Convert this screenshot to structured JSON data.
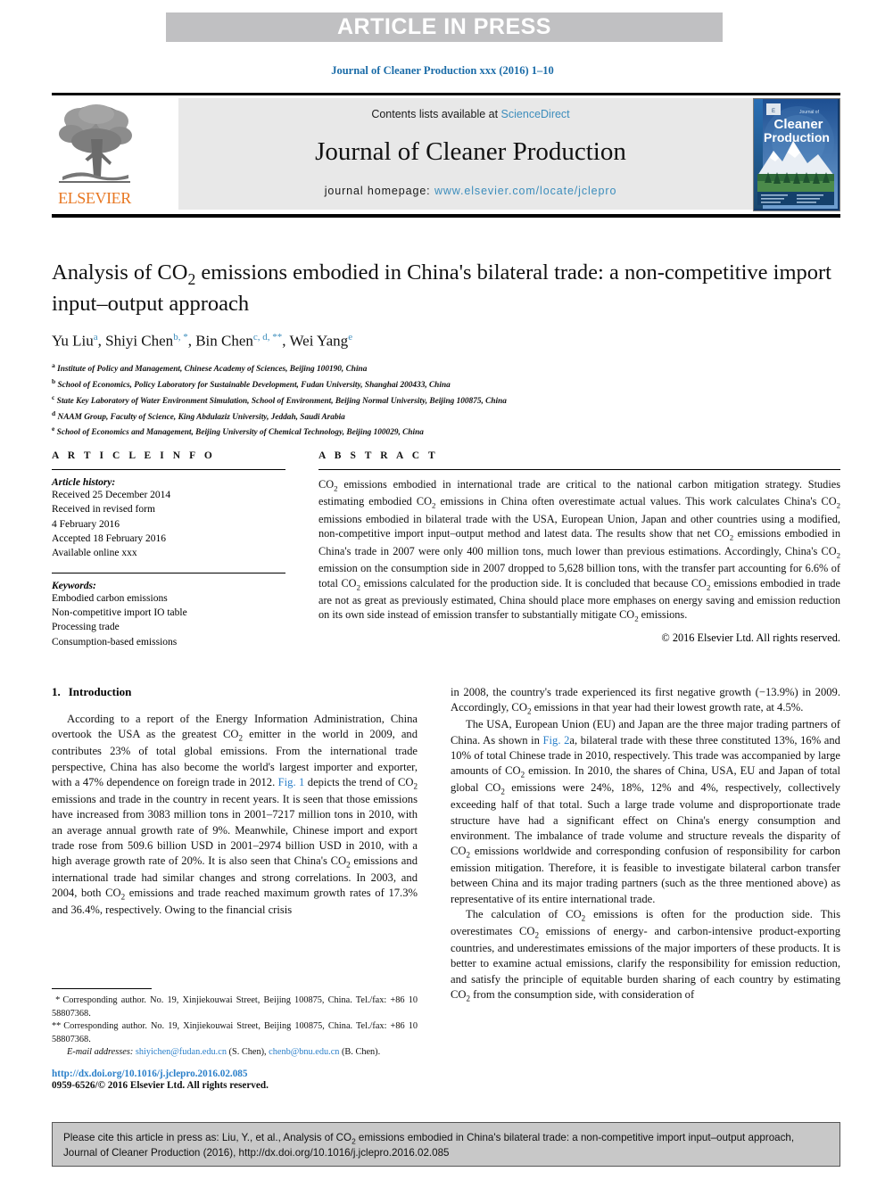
{
  "banner": {
    "text": "ARTICLE IN PRESS"
  },
  "journal_ref": "Journal of Cleaner Production xxx (2016) 1–10",
  "masthead": {
    "publisher_logo_label": "ELSEVIER",
    "contents_prefix": "Contents lists available at ",
    "contents_link": "ScienceDirect",
    "journal_name": "Journal of Cleaner Production",
    "homepage_prefix": "journal homepage: ",
    "homepage_url": "www.elsevier.com/locate/jclepro",
    "cover_title_small": "Journal of",
    "cover_title_line1": "Cleaner",
    "cover_title_line2": "Production"
  },
  "article": {
    "title": "Analysis of CO2 emissions embodied in China's bilateral trade: a non-competitive import input–output approach",
    "title_part1": "Analysis of CO",
    "title_sub": "2",
    "title_part2": " emissions embodied in China's bilateral trade: a non-competitive import input–output approach",
    "authors": [
      {
        "name": "Yu Liu",
        "marks": "a"
      },
      {
        "name": "Shiyi Chen",
        "marks": "b, *"
      },
      {
        "name": "Bin Chen",
        "marks": "c, d, **"
      },
      {
        "name": "Wei Yang",
        "marks": "e"
      }
    ],
    "affiliations": [
      {
        "mark": "a",
        "text": "Institute of Policy and Management, Chinese Academy of Sciences, Beijing 100190, China"
      },
      {
        "mark": "b",
        "text": "School of Economics, Policy Laboratory for Sustainable Development, Fudan University, Shanghai 200433, China"
      },
      {
        "mark": "c",
        "text": "State Key Laboratory of Water Environment Simulation, School of Environment, Beijing Normal University, Beijing 100875, China"
      },
      {
        "mark": "d",
        "text": "NAAM Group, Faculty of Science, King Abdulaziz University, Jeddah, Saudi Arabia"
      },
      {
        "mark": "e",
        "text": "School of Economics and Management, Beijing University of Chemical Technology, Beijing 100029, China"
      }
    ]
  },
  "article_info": {
    "heading": "A R T I C L E  I N F O",
    "history_label": "Article history:",
    "history": [
      "Received 25 December 2014",
      "Received in revised form",
      "4 February 2016",
      "Accepted 18 February 2016",
      "Available online xxx"
    ],
    "keywords_label": "Keywords:",
    "keywords": [
      "Embodied carbon emissions",
      "Non-competitive import IO table",
      "Processing trade",
      "Consumption-based emissions"
    ]
  },
  "abstract": {
    "heading": "A B S T R A C T",
    "p1_a": "CO",
    "p1_b": " emissions embodied in international trade are critical to the national carbon mitigation strategy. Studies estimating embodied CO",
    "p1_c": " emissions in China often overestimate actual values. This work calculates China's CO",
    "p1_d": " emissions embodied in bilateral trade with the USA, European Union, Japan and other countries using a modified, non-competitive import input–output method and latest data. The results show that net CO",
    "p1_e": " emissions embodied in China's trade in 2007 were only 400 million tons, much lower than previous estimations. Accordingly, China's CO",
    "p1_f": " emission on the consumption side in 2007 dropped to 5,628 billion tons, with the transfer part accounting for 6.6% of total CO",
    "p1_g": " emissions calculated for the production side. It is concluded that because CO",
    "p1_h": " emissions embodied in trade are not as great as previously estimated, China should place more emphases on energy saving and emission reduction on its own side instead of emission transfer to substantially mitigate CO",
    "p1_i": " emissions.",
    "copyright": "© 2016 Elsevier Ltd. All rights reserved."
  },
  "body": {
    "section_number": "1.",
    "section_title": "Introduction",
    "left_p1_a": "According to a report of the Energy Information Administration, China overtook the USA as the greatest CO",
    "left_p1_b": " emitter in the world in 2009, and contributes 23% of total global emissions. From the international trade perspective, China has also become the world's largest importer and exporter, with a 47% dependence on foreign trade in 2012. ",
    "left_p1_figref": "Fig. 1",
    "left_p1_c": " depicts the trend of CO",
    "left_p1_d": " emissions and trade in the country in recent years. It is seen that those emissions have increased from 3083 million tons in 2001–7217 million tons in 2010, with an average annual growth rate of 9%. Meanwhile, Chinese import and export trade rose from 509.6 billion USD in 2001–2974 billion USD in 2010, with a high average growth rate of 20%. It is also seen that China's CO",
    "left_p1_e": " emissions and international trade had similar changes and strong correlations. In 2003, and 2004, both CO",
    "left_p1_f": " emissions and trade reached maximum growth rates of 17.3% and 36.4%, respectively. Owing to the financial crisis",
    "right_p1_a": "in 2008, the country's trade experienced its first negative growth (−13.9%) in 2009. Accordingly, CO",
    "right_p1_b": " emissions in that year had their lowest growth rate, at 4.5%.",
    "right_p2_a": "The USA, European Union (EU) and Japan are the three major trading partners of China. As shown in ",
    "right_p2_figref": "Fig. 2",
    "right_p2_b": "a, bilateral trade with these three constituted 13%, 16% and 10% of total Chinese trade in 2010, respectively. This trade was accompanied by large amounts of CO",
    "right_p2_c": " emission. In 2010, the shares of China, USA, EU and Japan of total global CO",
    "right_p2_d": " emissions were 24%, 18%, 12% and 4%, respectively, collectively exceeding half of that total. Such a large trade volume and disproportionate trade structure have had a significant effect on China's energy consumption and environment. The imbalance of trade volume and structure reveals the disparity of CO",
    "right_p2_e": " emissions worldwide and corresponding confusion of responsibility for carbon emission mitigation. Therefore, it is feasible to investigate bilateral carbon transfer between China and its major trading partners (such as the three mentioned above) as representative of its entire international trade.",
    "right_p3_a": "The calculation of CO",
    "right_p3_b": " emissions is often for the production side. This overestimates CO",
    "right_p3_c": " emissions of energy- and carbon-intensive product-exporting countries, and underestimates emissions of the major importers of these products. It is better to examine actual emissions, clarify the responsibility for emission reduction, and satisfy the principle of equitable burden sharing of each country by estimating CO",
    "right_p3_d": " from the consumption side, with consideration of"
  },
  "footnotes": {
    "fn1_mark": "*",
    "fn1_text": "Corresponding author. No. 19, Xinjiekouwai Street, Beijing 100875, China. Tel./fax: +86 10 58807368.",
    "fn2_mark": "**",
    "fn2_text": "Corresponding author. No. 19, Xinjiekouwai Street, Beijing 100875, China. Tel./fax: +86 10 58807368.",
    "email_label": "E-mail addresses:",
    "email1": "shiyichen@fudan.edu.cn",
    "email1_owner": "(S. Chen),",
    "email2": "chenb@bnu.edu.cn",
    "email2_owner": "(B. Chen)."
  },
  "doi": {
    "url": "http://dx.doi.org/10.1016/j.jclepro.2016.02.085",
    "issn_line": "0959-6526/© 2016 Elsevier Ltd. All rights reserved."
  },
  "citation_box": {
    "prefix": "Please cite this article in press as: Liu, Y., et al., Analysis of CO",
    "sub": "2",
    "suffix": " emissions embodied in China's bilateral trade: a non-competitive import input–output approach, Journal of Cleaner Production (2016), http://dx.doi.org/10.1016/j.jclepro.2016.02.085"
  },
  "colors": {
    "banner_gray": "#c0c0c2",
    "link_blue": "#3c8dbc",
    "journal_blue": "#1b6ca8",
    "elsevier_orange": "#e87722",
    "contents_bg": "#e8e8e8",
    "cite_box_bg": "#c8c8c8"
  }
}
